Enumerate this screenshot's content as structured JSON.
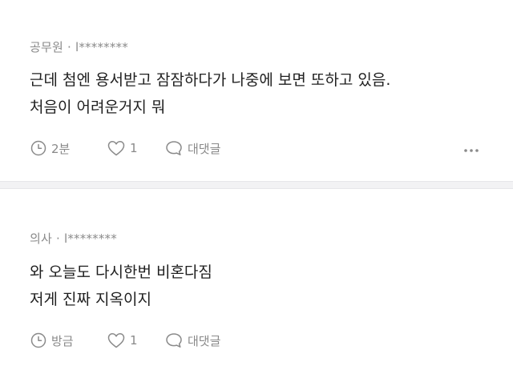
{
  "comments": [
    {
      "author_job": "공무원",
      "separator": "·",
      "author_id": "l********",
      "lines": [
        "근데 첨엔 용서받고 잠잠하다가 나중에 보면 또하고 있음.",
        "처음이 어려운거지 뭐"
      ],
      "time_label": "2분",
      "like_count": "1",
      "reply_label": "대댓글",
      "more_icon": "more-dots-icon"
    },
    {
      "author_job": "의사",
      "separator": "·",
      "author_id": "l********",
      "lines": [
        "와 오늘도 다시한번 비혼다짐",
        "저게 진짜 지옥이지"
      ],
      "time_label": "방금",
      "like_count": "1",
      "reply_label": "대댓글",
      "more_icon": "more-dots-icon"
    }
  ],
  "colors": {
    "meta_text": "#8a8a8a",
    "body_text": "#1f1f1f",
    "divider_band": "#f2f2f4"
  }
}
